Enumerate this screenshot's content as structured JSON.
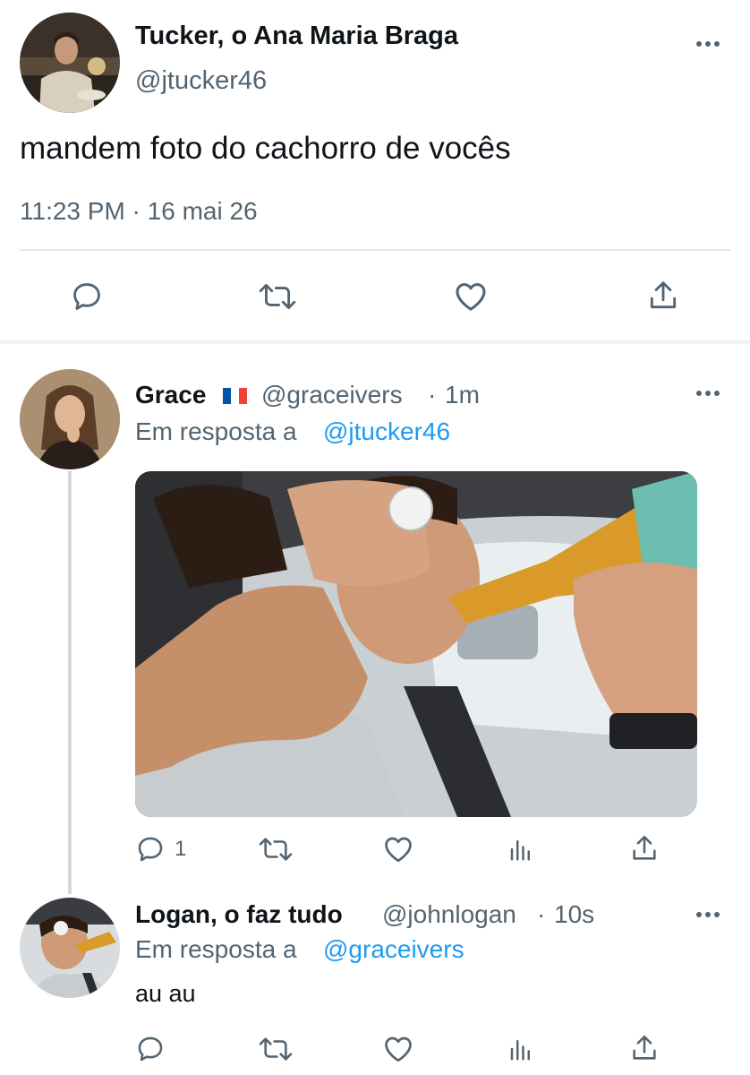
{
  "main_tweet": {
    "author_name": "Tucker, o Ana Maria Braga",
    "author_handle": "@jtucker46",
    "text": "mandem foto do cachorro de vocês",
    "timestamp": "11:23 PM · 16 mai 26",
    "actions": [
      "reply-icon",
      "retweet-icon",
      "like-icon",
      "share-icon"
    ]
  },
  "reply1": {
    "author_name": "Grace",
    "flag": "france-flag",
    "author_handle": "@graceivers",
    "separator": "·",
    "time": "1m",
    "reply_prefix": "Em resposta a",
    "reply_to": "@jtucker46",
    "reply_count": "1",
    "media": "photo of person drinking from bottle in car",
    "actions": [
      "reply-icon",
      "retweet-icon",
      "like-icon",
      "analytics-icon",
      "share-icon"
    ]
  },
  "reply2": {
    "author_name": "Logan, o faz tudo",
    "author_handle": "@johnlogan",
    "separator": "·",
    "time": "10s",
    "reply_prefix": "Em resposta a",
    "reply_to": "@graceivers",
    "text": "au au",
    "actions": [
      "reply-icon",
      "retweet-icon",
      "like-icon",
      "analytics-icon",
      "share-icon"
    ]
  },
  "colors": {
    "text": "#0f1419",
    "secondary": "#536471",
    "link": "#1d9bf0",
    "divider": "#e6e9ec"
  }
}
